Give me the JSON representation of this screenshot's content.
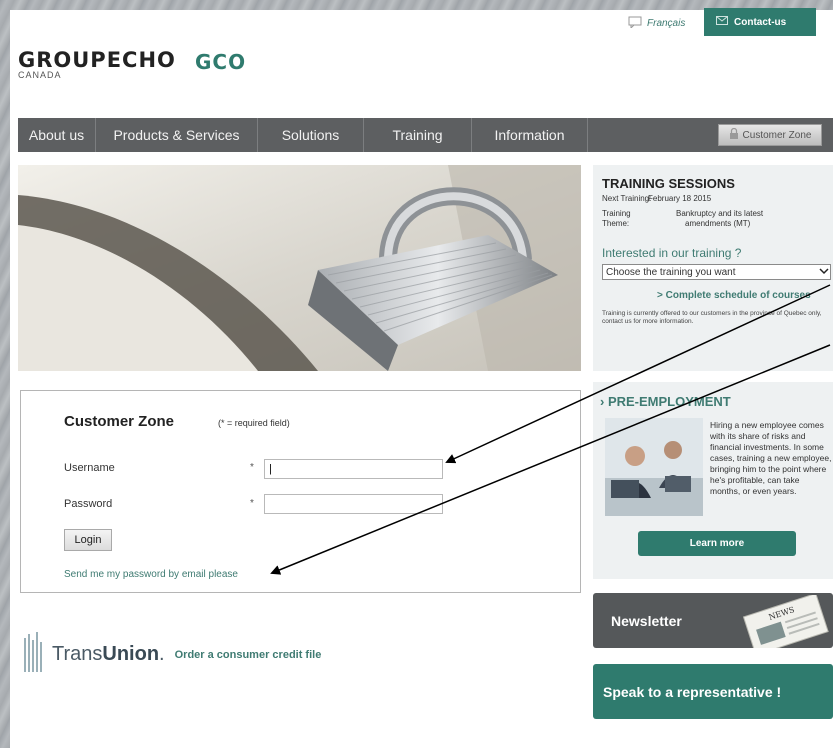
{
  "header": {
    "language_link": "Français",
    "contact_button": "Contact-us",
    "logo_text": "GROUPECHO",
    "logo_sub": "CANADA",
    "logo_mark": "GCO"
  },
  "nav": {
    "items": [
      {
        "label": "About us"
      },
      {
        "label": "Products & Services"
      },
      {
        "label": "Solutions"
      },
      {
        "label": "Training"
      },
      {
        "label": "Information"
      }
    ],
    "customer_zone_button": "Customer Zone"
  },
  "login": {
    "title": "Customer Zone",
    "required_note": "(* = required field)",
    "username_label": "Username",
    "password_label": "Password",
    "required_star": "*",
    "username_value": "|",
    "password_value": "",
    "login_button": "Login",
    "email_link": "Send me my password by email please"
  },
  "transunion": {
    "brand_plain": "Trans",
    "brand_bold": "Union",
    "link": "Order a consumer credit file"
  },
  "training": {
    "title": "TRAINING SESSIONS",
    "next_label": "Next Training:",
    "next_value": "February 18 2015",
    "theme_label_1": "Training",
    "theme_label_2": "Theme:",
    "theme_value_1": "Bankruptcy and its latest",
    "theme_value_2": "amendments (MT)",
    "interest": "Interested in our training ?",
    "select_value": "Choose the training you want",
    "schedule_link": "> Complete schedule of courses",
    "note": "Training is currently offered to our customers in the province of Quebec only, contact us for more information."
  },
  "pre_employment": {
    "title": "› PRE-EMPLOYMENT",
    "text": "Hiring a new employee comes with its share of risks and financial investments. In some cases, training a new employee, bringing him to the point where he's profitable, can take months, or even years.",
    "button": "Learn more"
  },
  "newsletter": {
    "label": "Newsletter",
    "badge": "NEWS"
  },
  "speak": {
    "label": "Speak to a representative !"
  },
  "colors": {
    "accent": "#2f7b6e",
    "nav": "#5d5f61"
  }
}
